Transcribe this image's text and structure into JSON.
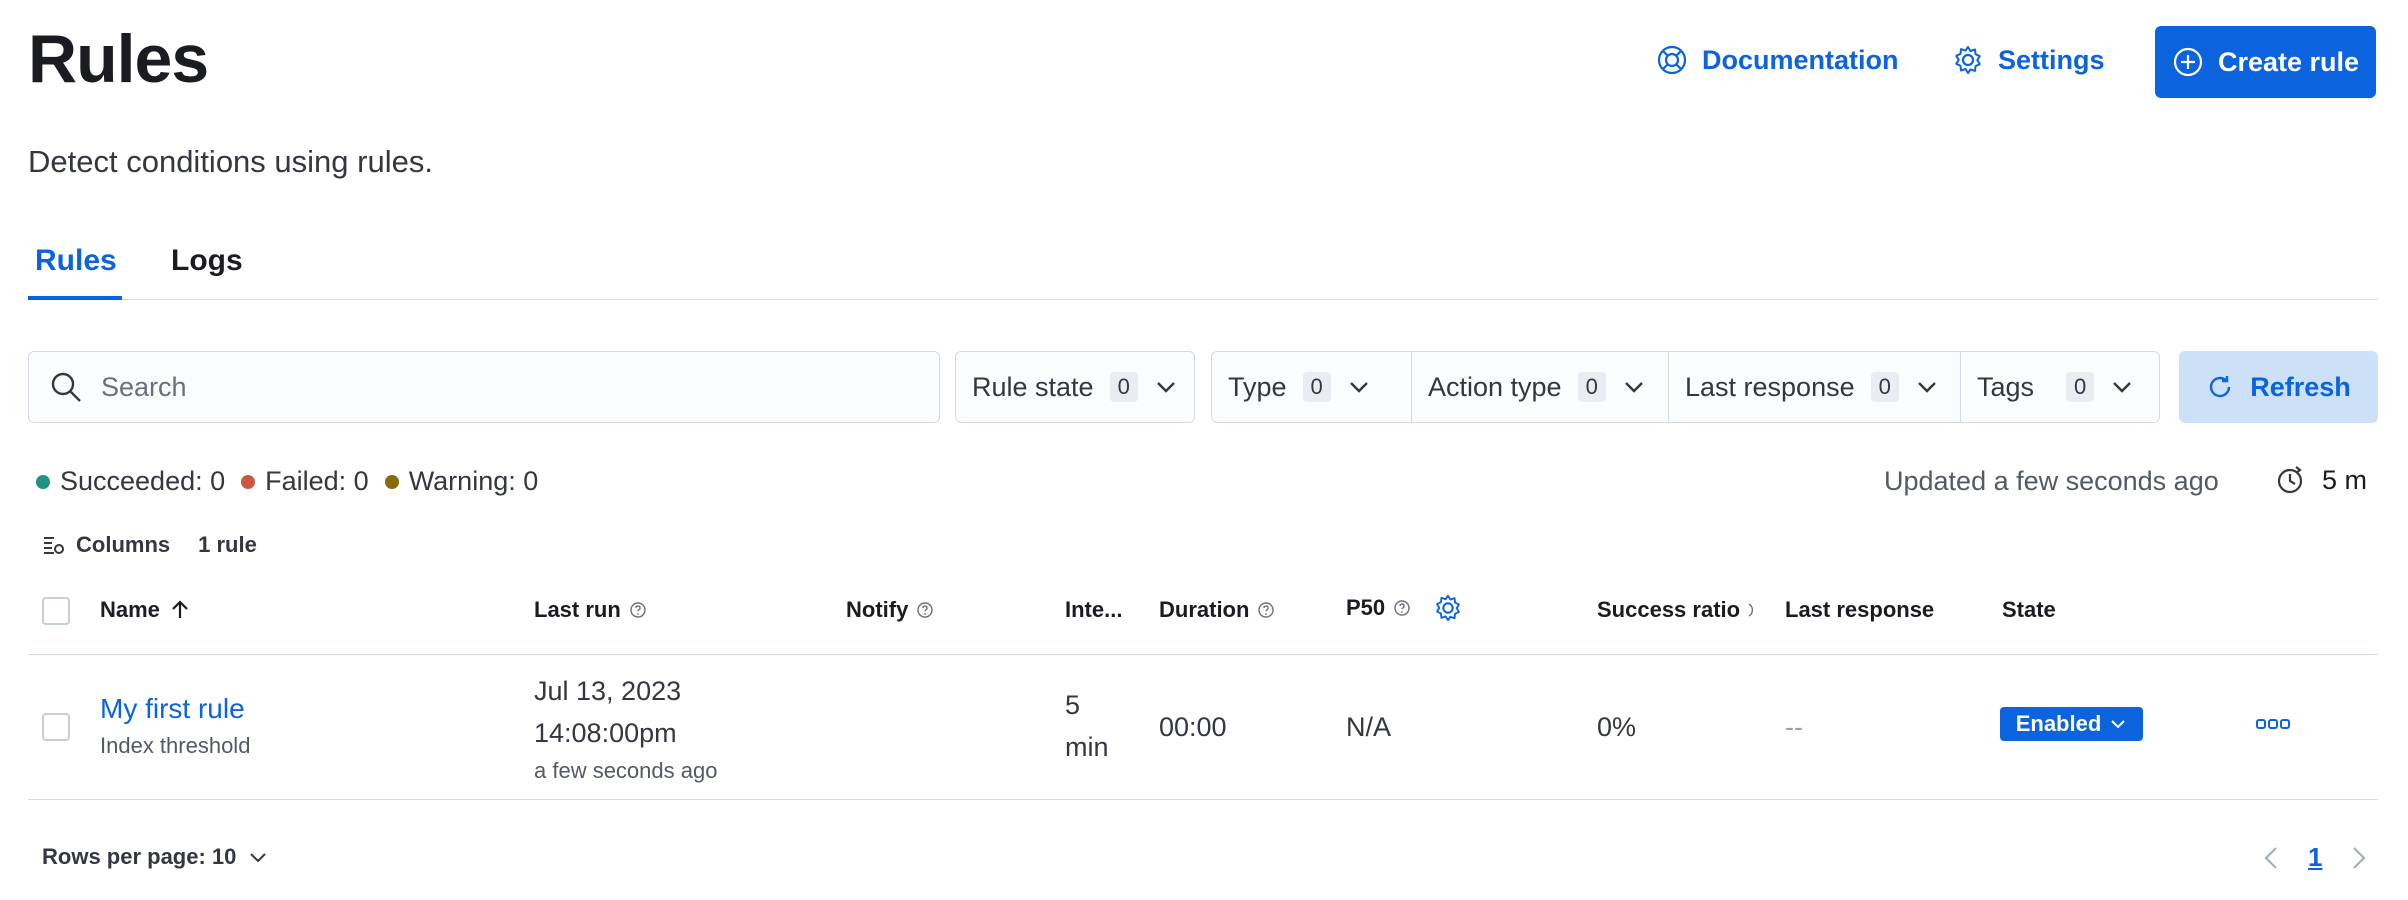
{
  "header": {
    "title": "Rules",
    "subtitle": "Detect conditions using rules.",
    "documentation_label": "Documentation",
    "settings_label": "Settings",
    "create_label": "Create rule"
  },
  "tabs": [
    {
      "label": "Rules",
      "active": true
    },
    {
      "label": "Logs",
      "active": false
    }
  ],
  "search": {
    "placeholder": "Search",
    "value": ""
  },
  "filters": [
    {
      "label": "Rule state",
      "count": "0"
    },
    {
      "label": "Type",
      "count": "0"
    },
    {
      "label": "Action type",
      "count": "0"
    },
    {
      "label": "Last response",
      "count": "0"
    },
    {
      "label": "Tags",
      "count": "0"
    }
  ],
  "refresh_label": "Refresh",
  "status": {
    "succeeded": "Succeeded: 0",
    "failed": "Failed: 0",
    "warning": "Warning: 0",
    "updated": "Updated a few seconds ago",
    "interval": "5 m",
    "colors": {
      "succeeded": "#209280",
      "failed": "#cc5642",
      "warning": "#8a6a0a"
    }
  },
  "columns_label": "Columns",
  "rule_count": "1 rule",
  "table": {
    "headers": {
      "name": "Name",
      "last_run": "Last run",
      "notify": "Notify",
      "interval": "Inte...",
      "duration": "Duration",
      "p50": "P50",
      "success_ratio": "Success ratio",
      "last_response": "Last response",
      "state": "State"
    },
    "rows": [
      {
        "name": "My first rule",
        "type": "Index threshold",
        "last_run_date": "Jul 13, 2023",
        "last_run_time": "14:08:00pm",
        "last_run_relative": "a few seconds ago",
        "interval_value": "5",
        "interval_unit": "min",
        "duration": "00:00",
        "p50": "N/A",
        "success_ratio": "0%",
        "last_response": "--",
        "state": "Enabled"
      }
    ]
  },
  "pagination": {
    "rows_per_page": "Rows per page: 10",
    "current_page": "1"
  },
  "accent_color": "#0b64dd"
}
